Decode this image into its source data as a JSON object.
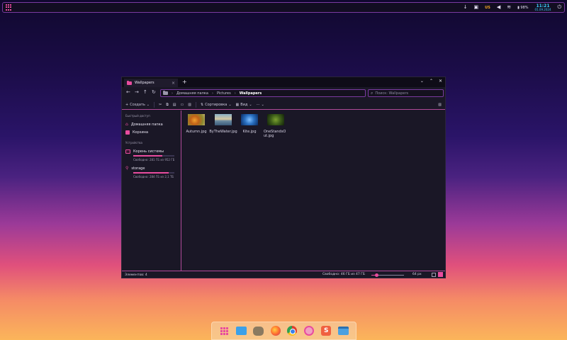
{
  "top_panel": {
    "keyboard_layout": "US",
    "battery": "98%",
    "time": "11:21",
    "date": "01.09.2024"
  },
  "window": {
    "tab_title": "Wallpapers",
    "search_placeholder": "Поиск: Wallpapers",
    "breadcrumbs": [
      "Домашняя папка",
      "Pictures",
      "Wallpapers"
    ]
  },
  "toolbar": {
    "create": "Создать",
    "sort": "Сортировка",
    "view": "Вид"
  },
  "sidebar": {
    "quick_access_header": "Быстрый доступ",
    "quick_access": [
      "Домашняя папка",
      "Корзина"
    ],
    "devices_header": "Устройства",
    "devices": [
      {
        "name": "Корень системы",
        "usage_text": "Свободно: 281 ГБ из 952 ГБ",
        "usage": 0.7
      },
      {
        "name": "storage",
        "usage_text": "Свободно: 284 ГБ из 2,1 ТБ",
        "usage": 0.87
      }
    ]
  },
  "files": [
    {
      "name": "Autumn.jpg",
      "thumb": "autumn"
    },
    {
      "name": "ByTheWater.jpg",
      "thumb": "water"
    },
    {
      "name": "Kite.jpg",
      "thumb": "kite"
    },
    {
      "name": "OneStandsOut.jpg",
      "thumb": "onestand"
    }
  ],
  "status": {
    "items": "Элементов: 4",
    "free": "Свободно: 46 ГБ из 47 ГБ",
    "zoom": "64 px"
  },
  "dock": [
    "app-grid",
    "files",
    "gimp",
    "firefox",
    "chrome",
    "pink-app",
    "s-app",
    "file-manager"
  ],
  "colors": {
    "accent": "#e84c9e",
    "border": "#b04a9a",
    "clock": "#3ed0ff"
  }
}
